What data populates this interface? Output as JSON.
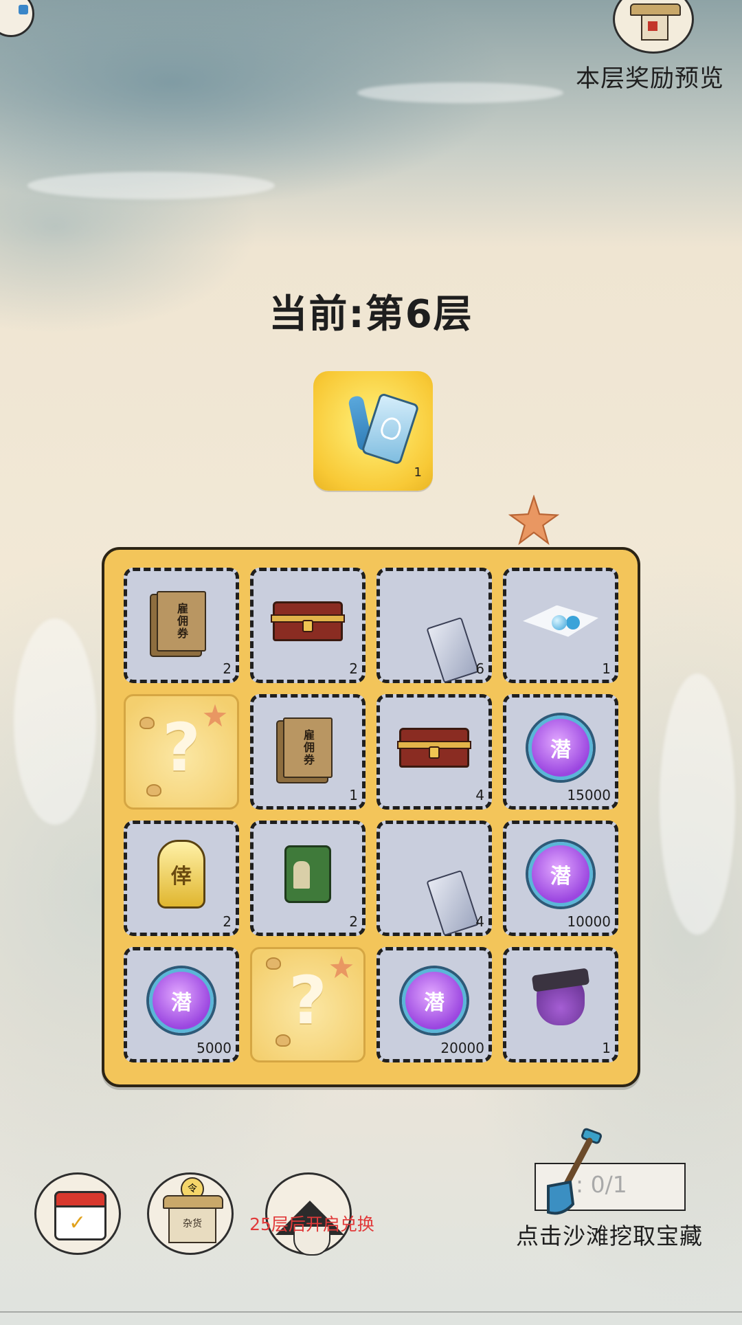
{
  "header": {
    "preview_label": "本层奖励预览"
  },
  "floor": {
    "title": "当前:第6层"
  },
  "featured_reward": {
    "icon": "blue-charm-tag-icon",
    "count": "1"
  },
  "grid": {
    "rows": [
      [
        {
          "icon": "hire-ticket-icon",
          "label": "雇佣券",
          "count": "2"
        },
        {
          "icon": "treasure-chest-icon",
          "count": "2"
        },
        {
          "icon": "scroll-icon",
          "count": "6"
        },
        {
          "icon": "pearl-cloth-icon",
          "count": "1"
        }
      ],
      [
        {
          "icon": "mystery-sand-icon",
          "mark": "?",
          "count": ""
        },
        {
          "icon": "hire-ticket-icon",
          "label": "雇佣券",
          "count": "1"
        },
        {
          "icon": "treasure-chest-icon",
          "count": "4"
        },
        {
          "icon": "dive-orb-icon",
          "glyph": "潜",
          "count": "15000"
        }
      ],
      [
        {
          "icon": "gold-badge-icon",
          "glyph": "倖",
          "count": "2"
        },
        {
          "icon": "recruit-bag-icon",
          "count": "2"
        },
        {
          "icon": "scroll-icon",
          "count": "4"
        },
        {
          "icon": "dive-orb-icon",
          "glyph": "潜",
          "count": "10000"
        }
      ],
      [
        {
          "icon": "dive-orb-icon",
          "glyph": "潜",
          "count": "5000"
        },
        {
          "icon": "mystery-sand-icon",
          "mark": "?",
          "count": ""
        },
        {
          "icon": "dive-orb-icon",
          "glyph": "潜",
          "count": "20000"
        },
        {
          "icon": "pirate-pouch-icon",
          "count": "1"
        }
      ]
    ]
  },
  "bottom": {
    "exchange_note": "25层后开启兑换",
    "shovel_count": ": 0/1",
    "dig_hint": "点击沙滩挖取宝藏",
    "shop_label": "杂货",
    "shop_coin": "令",
    "calendar_mark": "✓"
  },
  "colors": {
    "board": "#f3c55a",
    "cell": "#c9cedd",
    "note_red": "#e13a3a"
  }
}
